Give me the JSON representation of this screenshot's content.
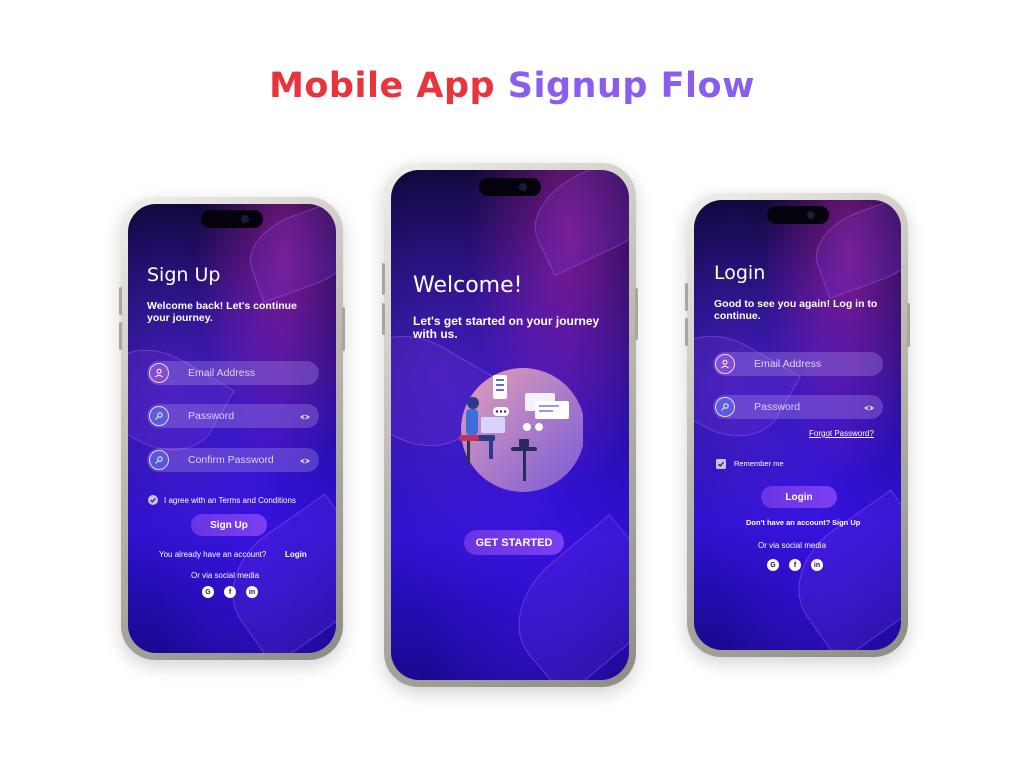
{
  "page_title": {
    "part1": "Mobile App",
    "part2": "Signup Flow"
  },
  "signup": {
    "title": "Sign Up",
    "subtitle": "Welcome back! Let's continue your journey.",
    "email_placeholder": "Email Address",
    "password_placeholder": "Password",
    "confirm_placeholder": "Confirm Password",
    "terms_text": "I agree with an Terms and Conditions",
    "button_label": "Sign Up",
    "have_account_text": "You already have an account?",
    "login_link": "Login",
    "social_text": "Or via social media",
    "social_icons": [
      "google-icon",
      "facebook-icon",
      "linkedin-icon"
    ]
  },
  "welcome": {
    "title": "Welcome!",
    "subtitle": "Let's get started on your journey with us.",
    "button_label": "GET STARTED"
  },
  "login": {
    "title": "Login",
    "subtitle": "Good to see you again! Log in to continue.",
    "email_placeholder": "Email Address",
    "password_placeholder": "Password",
    "forgot_link": "Forgot Password?",
    "remember_label": "Remember me",
    "button_label": "Login",
    "no_account_text": "Don't have an account?",
    "signup_link": "Sign Up",
    "social_text": "Or via social media",
    "social_icons": [
      "google-icon",
      "facebook-icon",
      "linkedin-icon"
    ]
  },
  "colors": {
    "title_red": "#e8343d",
    "title_purple": "#8a5cf0",
    "button": "#6a34e0"
  }
}
